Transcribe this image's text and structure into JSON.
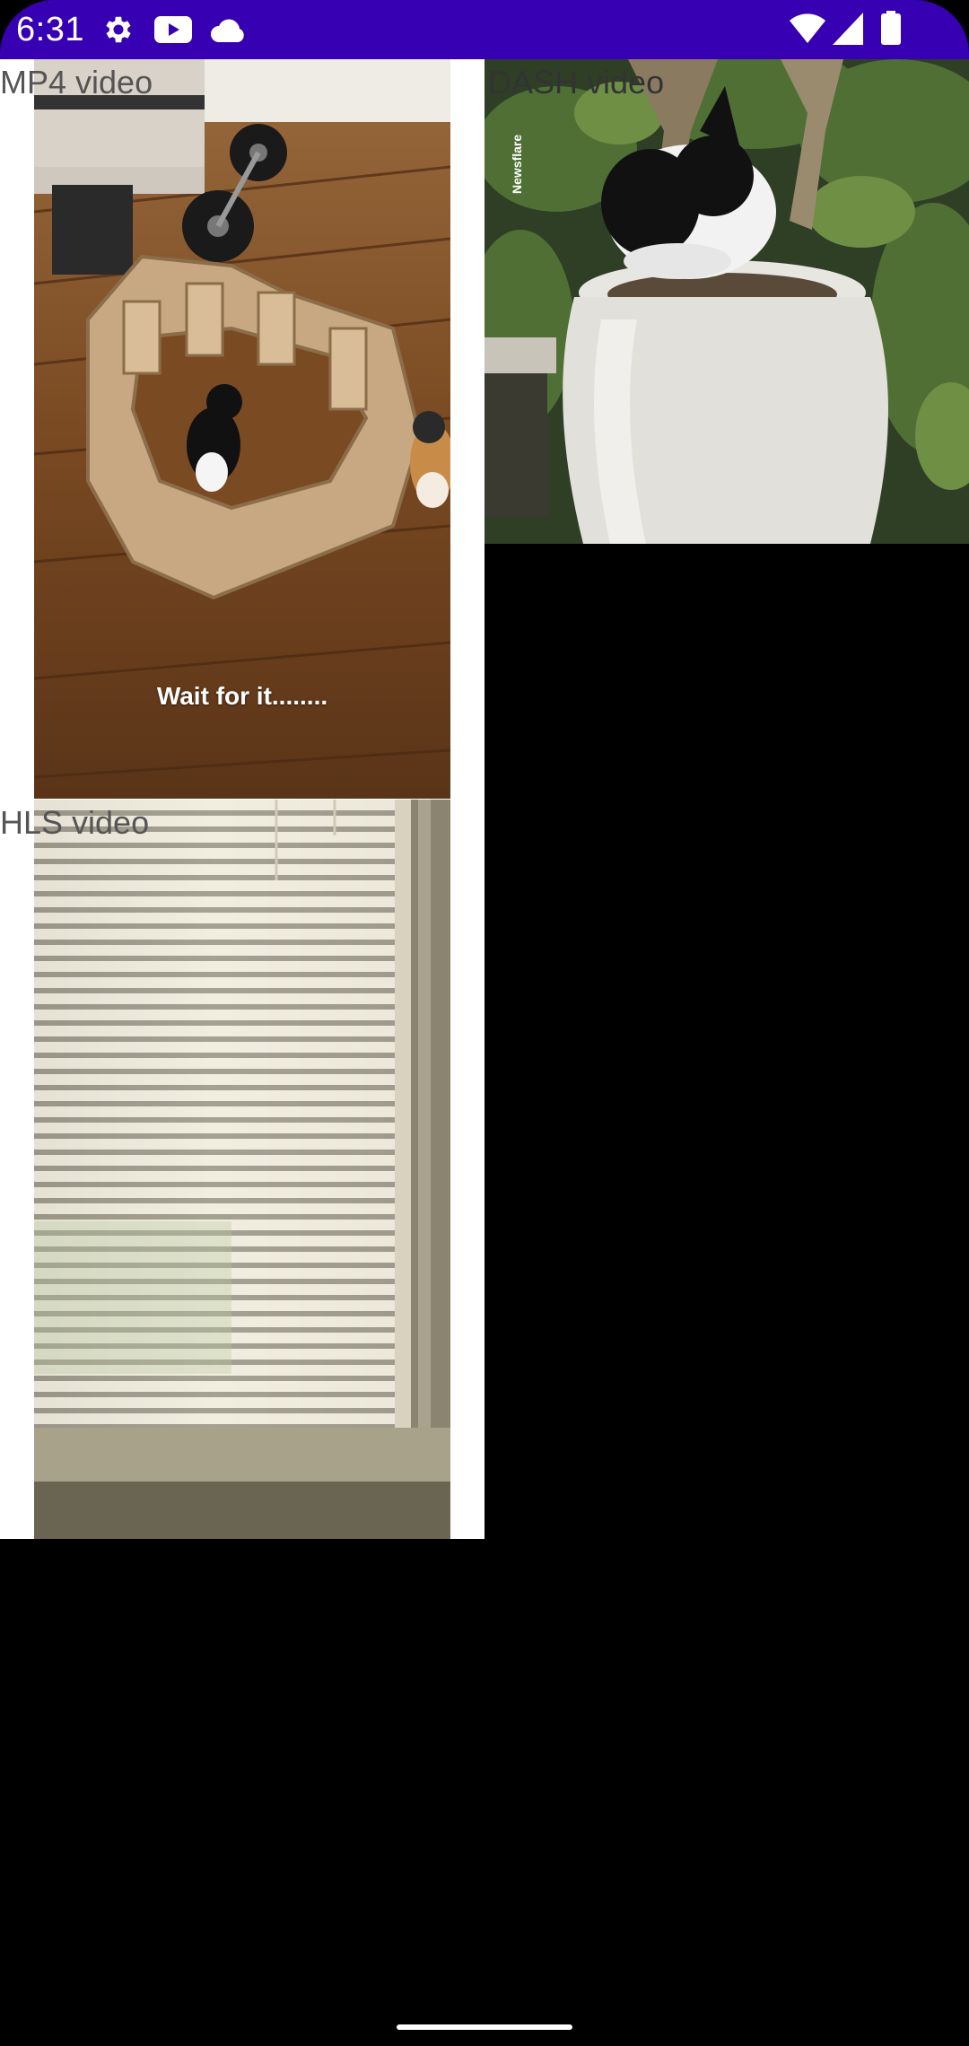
{
  "status_bar": {
    "time": "6:31",
    "icons": [
      "gear-icon",
      "youtube-icon",
      "cloud-icon",
      "wifi-icon",
      "signal-icon",
      "battery-icon"
    ],
    "background_color": "#3700b3"
  },
  "videos": {
    "mp4": {
      "label": "MP4 video",
      "caption": "Wait for it........"
    },
    "dash": {
      "label": "DASH video",
      "watermark": "Newsflare"
    },
    "hls": {
      "label": "HLS video"
    }
  }
}
